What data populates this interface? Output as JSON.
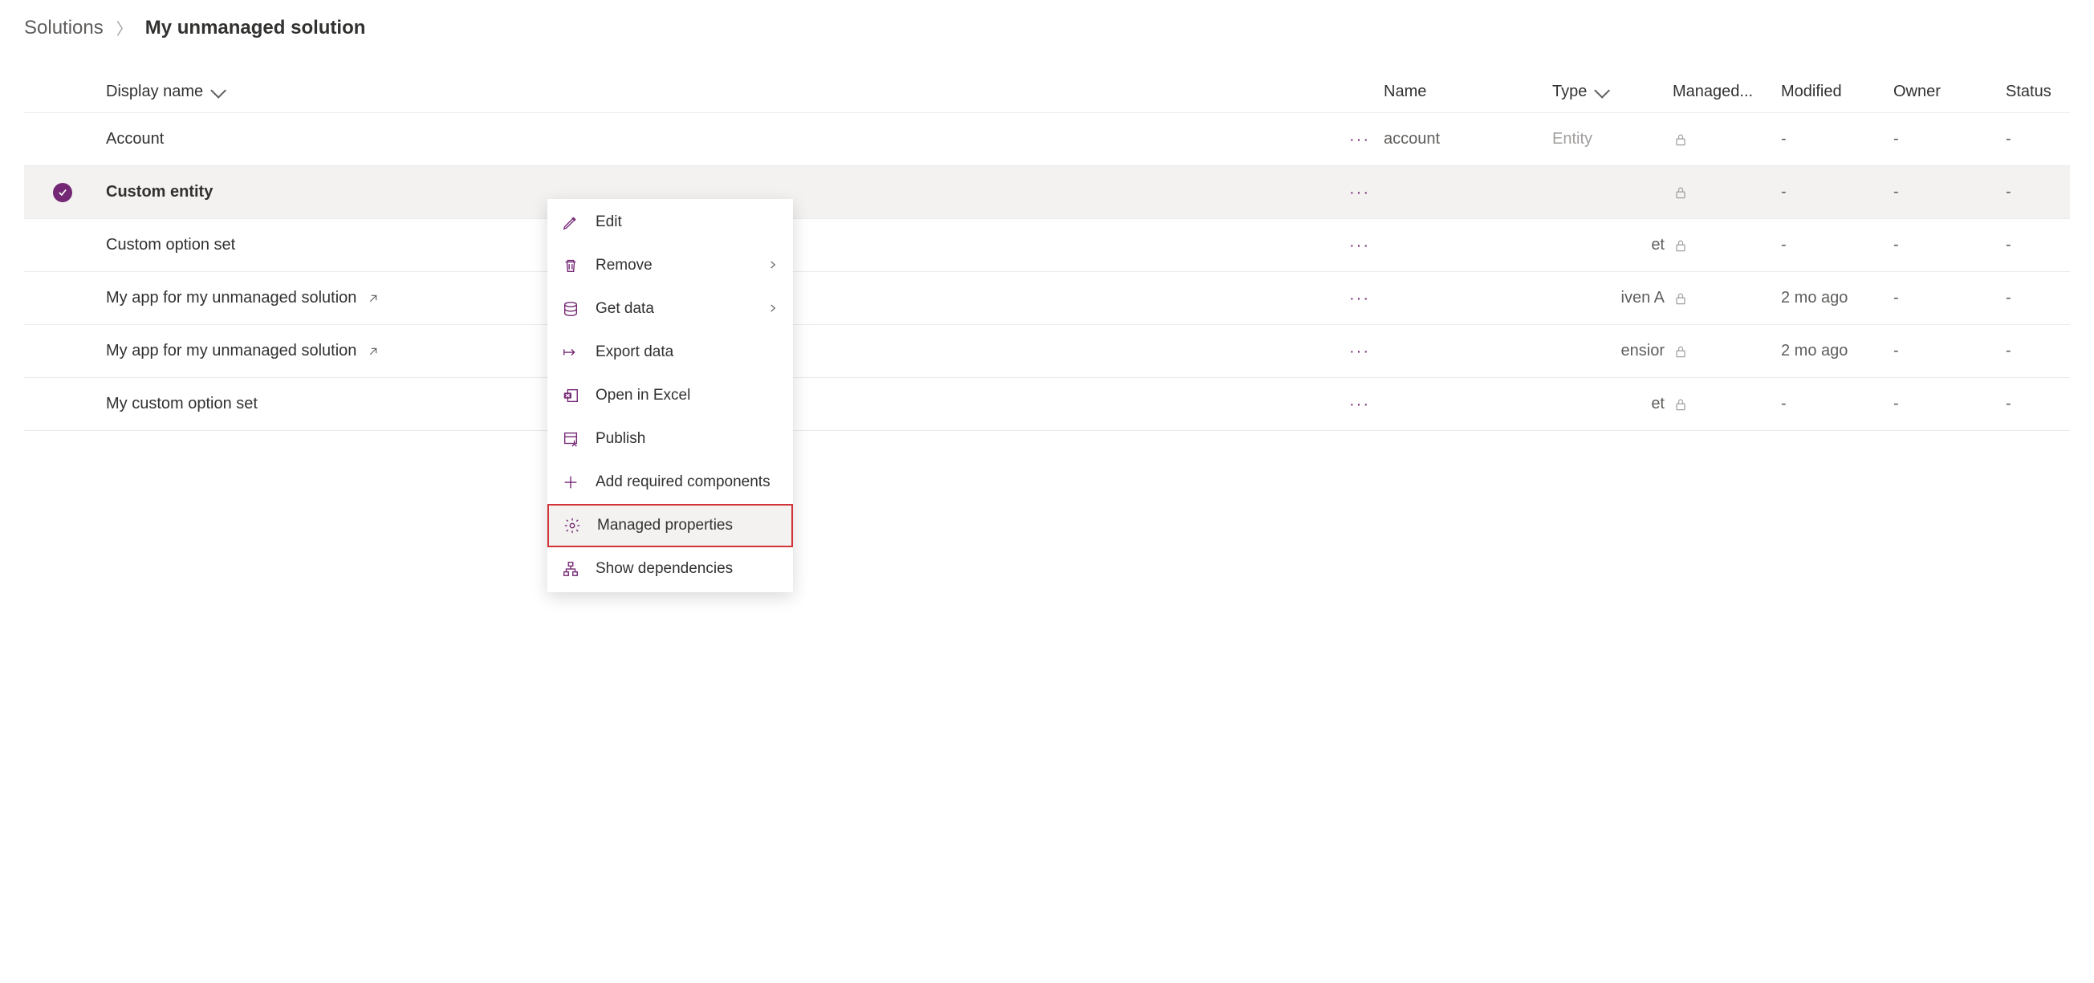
{
  "breadcrumb": {
    "root": "Solutions",
    "current": "My unmanaged solution"
  },
  "columns": {
    "display_name": "Display name",
    "name": "Name",
    "type": "Type",
    "managed": "Managed...",
    "modified": "Modified",
    "owner": "Owner",
    "status": "Status"
  },
  "rows": [
    {
      "display_name": "Account",
      "name": "account",
      "type": "Entity",
      "modified": "-",
      "owner": "-",
      "status": "-",
      "selected": false,
      "external": false
    },
    {
      "display_name": "Custom entity",
      "name": "",
      "type": "",
      "modified": "-",
      "owner": "-",
      "status": "-",
      "selected": true,
      "external": false
    },
    {
      "display_name": "Custom option set",
      "name": "",
      "type_suffix": "et",
      "modified": "-",
      "owner": "-",
      "status": "-",
      "selected": false,
      "external": false
    },
    {
      "display_name": "My app for my unmanaged solution",
      "name": "",
      "type_suffix": "iven A",
      "modified": "2 mo ago",
      "owner": "-",
      "status": "-",
      "selected": false,
      "external": true
    },
    {
      "display_name": "My app for my unmanaged solution",
      "name": "",
      "type_suffix": "ensior",
      "modified": "2 mo ago",
      "owner": "-",
      "status": "-",
      "selected": false,
      "external": true
    },
    {
      "display_name": "My custom option set",
      "name": "",
      "type_suffix": "et",
      "modified": "-",
      "owner": "-",
      "status": "-",
      "selected": false,
      "external": false
    }
  ],
  "menu": {
    "edit": "Edit",
    "remove": "Remove",
    "get_data": "Get data",
    "export_data": "Export data",
    "open_excel": "Open in Excel",
    "publish": "Publish",
    "add_required": "Add required components",
    "managed_properties": "Managed properties",
    "show_dependencies": "Show dependencies"
  }
}
